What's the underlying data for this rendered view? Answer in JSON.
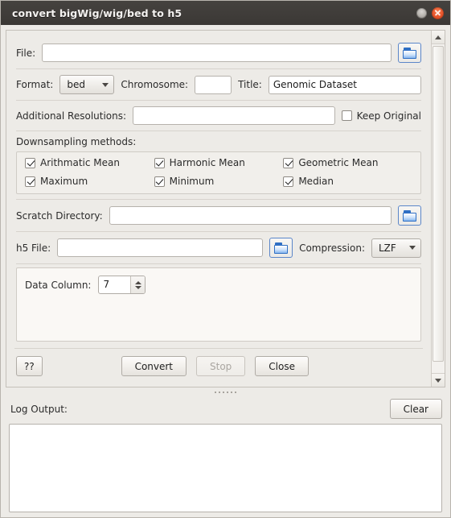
{
  "window": {
    "title": "convert bigWig/wig/bed to h5",
    "minimize_label": "minimize",
    "close_label": "close"
  },
  "form": {
    "file": {
      "label": "File:",
      "value": "",
      "placeholder": "",
      "browse_icon": "folder-icon"
    },
    "format": {
      "label": "Format:",
      "value": "bed"
    },
    "chromosome": {
      "label": "Chromosome:",
      "value": "",
      "placeholder": ""
    },
    "title": {
      "label": "Title:",
      "value": "Genomic Dataset",
      "placeholder": ""
    },
    "additional_resolutions": {
      "label": "Additional Resolutions:",
      "value": "",
      "placeholder": ""
    },
    "keep_original": {
      "label": "Keep Original",
      "checked": false
    },
    "downsampling": {
      "label": "Downsampling methods:",
      "methods": [
        {
          "label": "Arithmatic Mean",
          "checked": true
        },
        {
          "label": "Harmonic Mean",
          "checked": true
        },
        {
          "label": "Geometric Mean",
          "checked": true
        },
        {
          "label": "Maximum",
          "checked": true
        },
        {
          "label": "Minimum",
          "checked": true
        },
        {
          "label": "Median",
          "checked": true
        }
      ]
    },
    "scratch_directory": {
      "label": "Scratch Directory:",
      "value": "",
      "placeholder": "",
      "browse_icon": "folder-icon"
    },
    "h5_file": {
      "label": "h5 File:",
      "value": "",
      "placeholder": "",
      "browse_icon": "folder-icon"
    },
    "compression": {
      "label": "Compression:",
      "value": "LZF"
    },
    "data_column": {
      "label": "Data Column:",
      "value": "7"
    }
  },
  "actions": {
    "help_label": "??",
    "convert_label": "Convert",
    "stop_label": "Stop",
    "stop_enabled": false,
    "close_label": "Close"
  },
  "log": {
    "label": "Log Output:",
    "clear_label": "Clear",
    "content": ""
  }
}
